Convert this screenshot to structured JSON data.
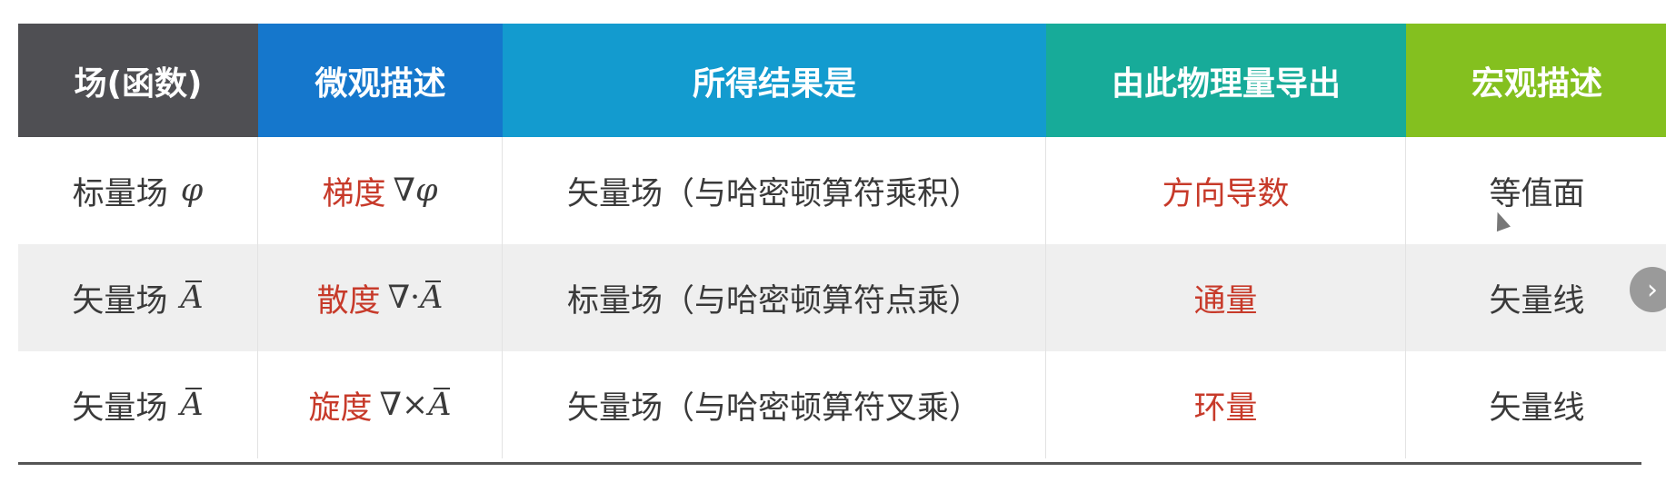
{
  "headers": [
    "场(函数)",
    "微观描述",
    "所得结果是",
    "由此物理量导出",
    "宏观描述"
  ],
  "rows": [
    {
      "field": "标量场",
      "field_symbol": "φ",
      "micro": "梯度",
      "micro_op": "∇",
      "micro_symbol": "φ",
      "result": "矢量场（与哈密顿算符乘积）",
      "derived": "方向导数",
      "macro": "等值面"
    },
    {
      "field": "矢量场",
      "field_symbol": "A",
      "micro": "散度",
      "micro_op": "∇·",
      "micro_symbol": "A",
      "result": "标量场（与哈密顿算符点乘）",
      "derived": "通量",
      "macro": "矢量线"
    },
    {
      "field": "矢量场",
      "field_symbol": "A",
      "micro": "旋度",
      "micro_op": "∇×",
      "micro_symbol": "A",
      "result": "矢量场（与哈密顿算符叉乘）",
      "derived": "环量",
      "macro": "矢量线"
    }
  ],
  "colors": {
    "header_col1": "#4f4f53",
    "header_col2": "#1577cc",
    "header_col3": "#139bcf",
    "header_col4": "#17ab99",
    "header_col5": "#84c01f",
    "highlight_red": "#c73a2a"
  },
  "icons": {
    "next_button": "chevron-right-icon",
    "cursor": "mouse-cursor-icon"
  }
}
